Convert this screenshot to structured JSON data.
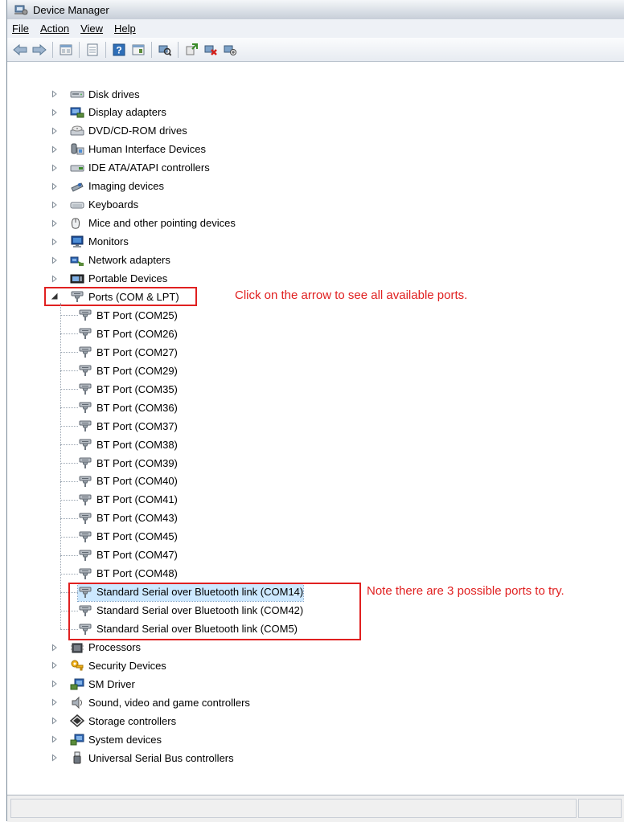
{
  "window": {
    "title": "Device Manager"
  },
  "menu": [
    {
      "label": "File"
    },
    {
      "label": "Action"
    },
    {
      "label": "View"
    },
    {
      "label": "Help"
    }
  ],
  "toolbar": {
    "buttons": [
      "back-icon",
      "forward-icon",
      "properties-icon",
      "view-icon",
      "help-icon",
      "details-icon",
      "scan-icon",
      "update-driver-icon",
      "uninstall-icon",
      "disable-icon"
    ]
  },
  "tree": {
    "categories_top": [
      {
        "label": "Disk drives",
        "icon": "disk-drive-icon"
      },
      {
        "label": "Display adapters",
        "icon": "display-adapter-icon"
      },
      {
        "label": "DVD/CD-ROM drives",
        "icon": "dvd-drive-icon"
      },
      {
        "label": "Human Interface Devices",
        "icon": "hid-icon"
      },
      {
        "label": "IDE ATA/ATAPI controllers",
        "icon": "ide-controller-icon"
      },
      {
        "label": "Imaging devices",
        "icon": "imaging-device-icon"
      },
      {
        "label": "Keyboards",
        "icon": "keyboard-icon"
      },
      {
        "label": "Mice and other pointing devices",
        "icon": "mouse-icon"
      },
      {
        "label": "Monitors",
        "icon": "monitor-icon"
      },
      {
        "label": "Network adapters",
        "icon": "network-adapter-icon"
      },
      {
        "label": "Portable Devices",
        "icon": "portable-device-icon"
      }
    ],
    "ports": {
      "label": "Ports (COM & LPT)",
      "children": [
        "BT Port (COM25)",
        "BT Port (COM26)",
        "BT Port (COM27)",
        "BT Port (COM29)",
        "BT Port (COM35)",
        "BT Port (COM36)",
        "BT Port (COM37)",
        "BT Port (COM38)",
        "BT Port (COM39)",
        "BT Port (COM40)",
        "BT Port (COM41)",
        "BT Port (COM43)",
        "BT Port (COM45)",
        "BT Port (COM47)",
        "BT Port (COM48)",
        "Standard Serial over Bluetooth link (COM14)",
        "Standard Serial over Bluetooth link (COM42)",
        "Standard Serial over Bluetooth link (COM5)"
      ]
    },
    "categories_bottom": [
      {
        "label": "Processors",
        "icon": "processor-icon"
      },
      {
        "label": "Security Devices",
        "icon": "security-device-icon"
      },
      {
        "label": "SM Driver",
        "icon": "sm-driver-icon"
      },
      {
        "label": "Sound, video and game controllers",
        "icon": "sound-icon"
      },
      {
        "label": "Storage controllers",
        "icon": "storage-controller-icon"
      },
      {
        "label": "System devices",
        "icon": "system-device-icon"
      },
      {
        "label": "Universal Serial Bus controllers",
        "icon": "usb-icon"
      }
    ]
  },
  "annotations": {
    "ports_note": "Click on the arrow to see all available ports.",
    "serial_note": "Note there are 3 possible ports to try."
  },
  "colors": {
    "annotation": "#e02020",
    "selection": "#cce8ff"
  }
}
